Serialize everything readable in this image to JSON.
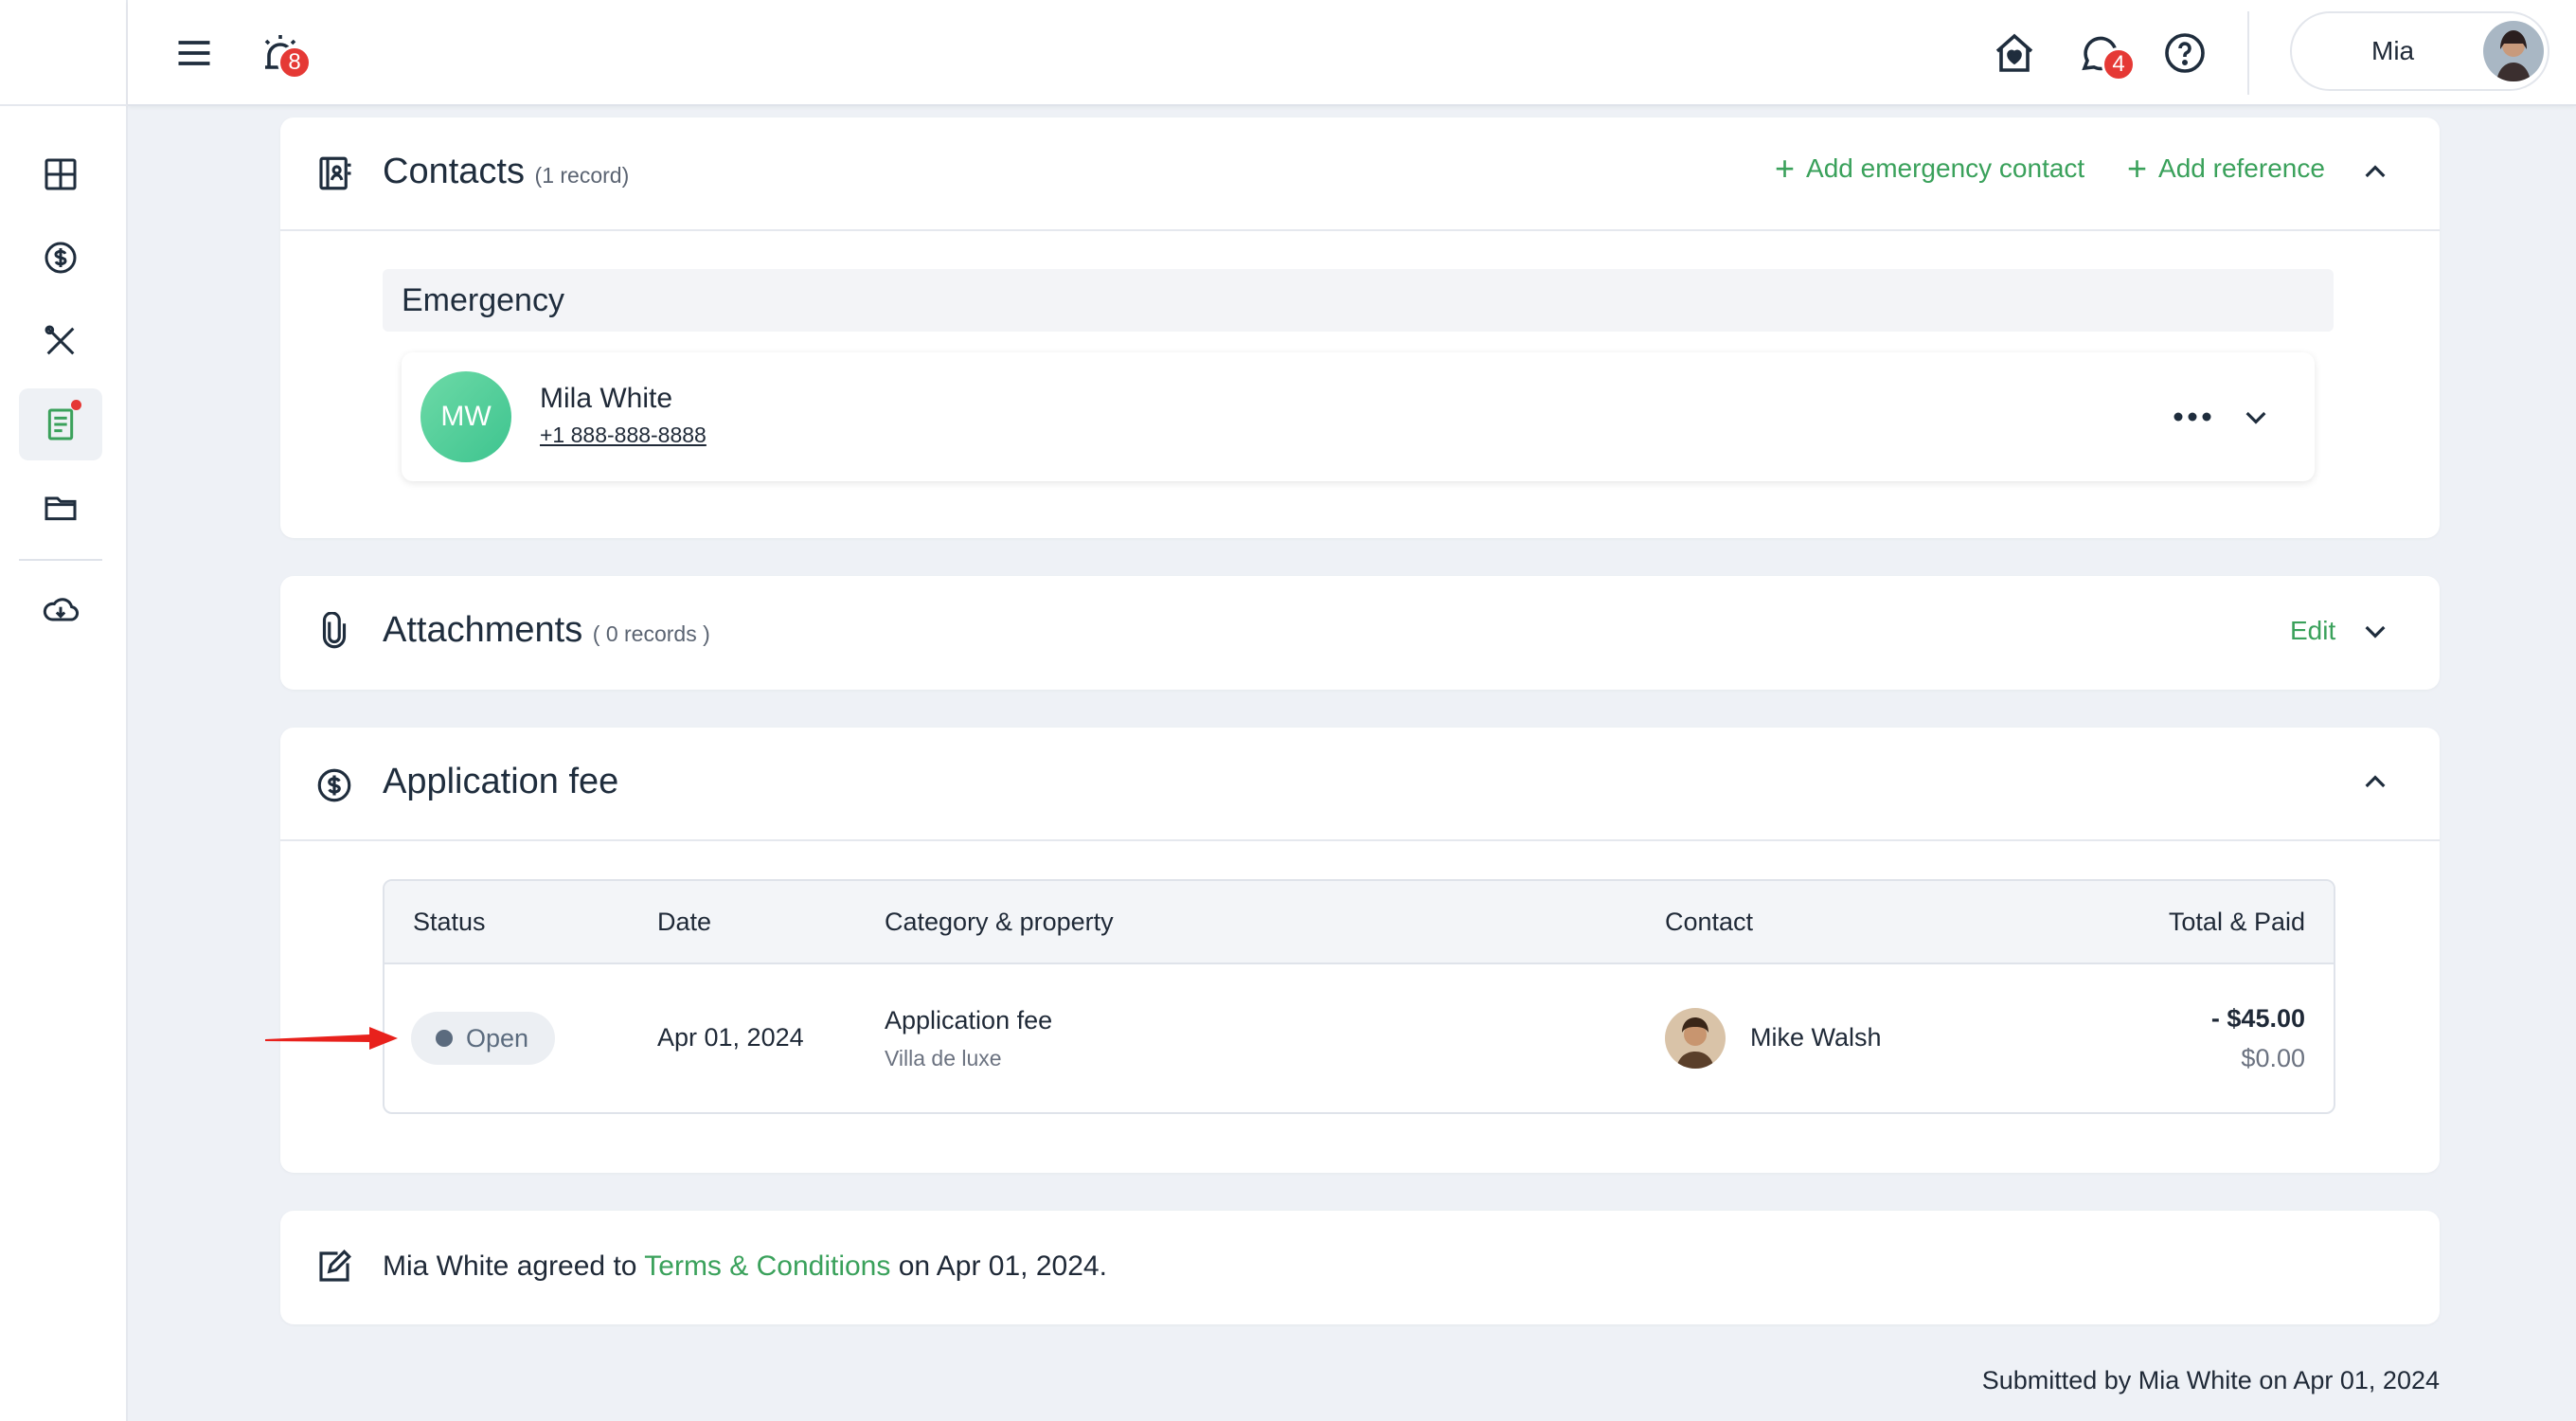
{
  "topbar": {
    "alerts_badge": "8",
    "messages_badge": "4",
    "user_name": "Mia"
  },
  "sidebar": {
    "items": [
      {
        "name": "dashboard"
      },
      {
        "name": "payments"
      },
      {
        "name": "maintenance"
      },
      {
        "name": "applications",
        "active": true
      },
      {
        "name": "files"
      },
      {
        "name": "download"
      }
    ]
  },
  "contacts": {
    "title": "Contacts",
    "count": "(1 record)",
    "add_emergency": "Add emergency contact",
    "add_reference": "Add reference",
    "group_label": "Emergency",
    "contact": {
      "initials": "MW",
      "name": "Mila White",
      "phone": "+1 888-888-8888"
    }
  },
  "attachments": {
    "title": "Attachments",
    "count": "( 0 records )",
    "edit_label": "Edit"
  },
  "application_fee": {
    "title": "Application fee",
    "columns": {
      "status": "Status",
      "date": "Date",
      "category": "Category & property",
      "contact": "Contact",
      "total": "Total & Paid"
    },
    "row": {
      "status": "Open",
      "date": "Apr 01, 2024",
      "category": "Application fee",
      "property": "Villa de luxe",
      "contact": "Mike Walsh",
      "total": "- $45.00",
      "paid": "$0.00"
    }
  },
  "terms": {
    "prefix": "Mia White agreed to",
    "link": "Terms & Conditions",
    "suffix": "on Apr 01, 2024."
  },
  "footer": {
    "submitted": "Submitted by Mia White on Apr 01, 2024"
  },
  "colors": {
    "accent_green": "#3aa15b",
    "badge_red": "#e53935",
    "background": "#eef1f6"
  }
}
